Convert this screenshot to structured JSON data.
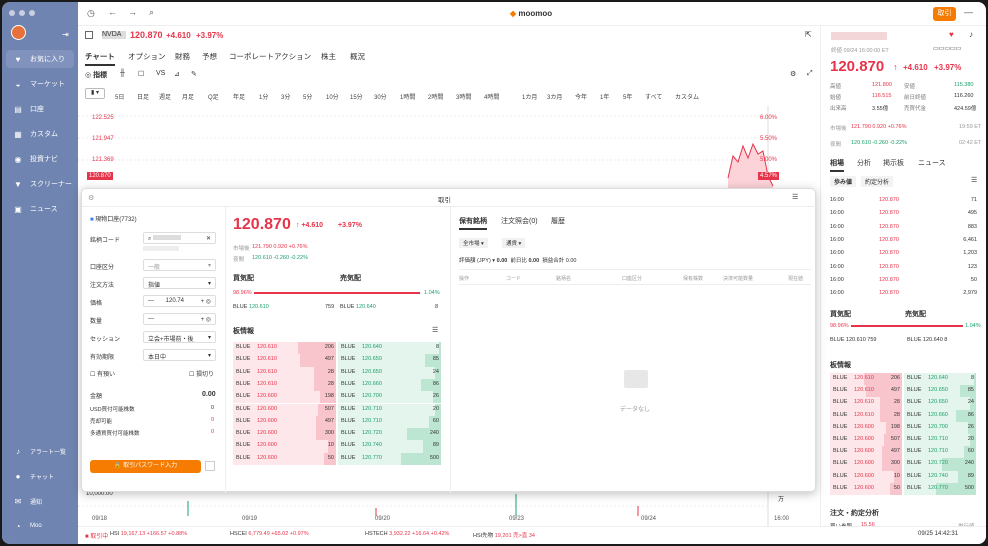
{
  "sidebar": {
    "items": [
      {
        "label": "お気に入り",
        "icon": "heart-icon",
        "glyph": "♥"
      },
      {
        "label": "マーケット",
        "icon": "market-icon",
        "glyph": "◒"
      },
      {
        "label": "口座",
        "icon": "wallet-icon",
        "glyph": "▤"
      },
      {
        "label": "カスタム",
        "icon": "custom-icon",
        "glyph": "▦"
      },
      {
        "label": "投資ナビ",
        "icon": "compass-icon",
        "glyph": "◉"
      },
      {
        "label": "スクリーナー",
        "icon": "filter-icon",
        "glyph": "▼"
      },
      {
        "label": "ニュース",
        "icon": "news-icon",
        "glyph": "▣"
      }
    ],
    "bottom": [
      {
        "label": "アラート一覧",
        "icon": "bell-icon",
        "glyph": "♪"
      },
      {
        "label": "チャット",
        "icon": "chat-icon",
        "glyph": "●"
      },
      {
        "label": "通知",
        "icon": "mail-icon",
        "glyph": "✉"
      },
      {
        "label": "Moo",
        "icon": "moo-icon",
        "glyph": "◔"
      }
    ]
  },
  "top": {
    "logo": "moomoo",
    "trade_btn": "取引"
  },
  "header": {
    "ticker": "NVDA",
    "price": "120.870",
    "change": "+4.610",
    "pct": "+3.97%"
  },
  "tabs": [
    "チャート",
    "オプション",
    "財務",
    "予想",
    "コーポレートアクション",
    "株主",
    "概況"
  ],
  "toolbar": {
    "indicator": "指標",
    "vs": "VS"
  },
  "timeframes": [
    "5日",
    "日足",
    "週足",
    "月足",
    "Q足",
    "年足",
    "1分",
    "3分",
    "5分",
    "10分",
    "15分",
    "30分",
    "1時間",
    "2時間",
    "3時間",
    "4時間",
    "1カ月",
    "3カ月",
    "今年",
    "1年",
    "5年",
    "すべて",
    "カスタム"
  ],
  "chart": {
    "y_labels": [
      "122.525",
      "121.947",
      "121.369",
      "120.870"
    ],
    "pct_labels": [
      "6.00%",
      "5.50%",
      "5.00%",
      "4.57%"
    ],
    "vol_label": "10,000.00",
    "vol_unit": "万",
    "x_labels": [
      "09/18",
      "09/19",
      "09/20",
      "09/23",
      "09/24",
      "16:00"
    ]
  },
  "dialog": {
    "title": "取引",
    "account": "現物口座(7732)",
    "labels": [
      "銘柄コード",
      "口座区分",
      "注文方法",
      "価格",
      "数量",
      "セッション",
      "有効期限"
    ],
    "acct_type": "一般",
    "order_type": "指値",
    "price": "120.74",
    "session": "立会+市場前・後",
    "expiry": "本日中",
    "chk1": "有預い",
    "chk2": "損切り",
    "amount_label": "金額",
    "amount": "0.00",
    "rows": [
      {
        "k": "USD買付可能株数",
        "v": "0"
      },
      {
        "k": "売却可能",
        "v": "0"
      },
      {
        "k": "多通貨買付可能株数",
        "v": "0"
      }
    ],
    "pwd_btn": "取引パスワード入力",
    "quote_price": "120.870",
    "quote_change": "+4.610",
    "quote_pct": "+3.97%",
    "pre_label": "市場後",
    "pre": "121.790  0.920  +0.76%",
    "post_label": "夜間",
    "post": "120.610  -0.260  -0.22%",
    "bid_label": "買気配",
    "ask_label": "売気配",
    "bid_pct": "98.96%",
    "ask_pct": "1.04%",
    "bid_ex": "BLUE",
    "bid_p": "120.610",
    "bid_q": "759",
    "ask_ex": "BLUE",
    "ask_p": "120.640",
    "ask_q": "8",
    "book_title": "板情報",
    "book": [
      [
        "BLUE",
        "120.610",
        "206",
        "BLUE",
        "120.640",
        "8"
      ],
      [
        "BLUE",
        "120.610",
        "497",
        "BLUE",
        "120.650",
        "85"
      ],
      [
        "BLUE",
        "120.610",
        "28",
        "BLUE",
        "120.650",
        "24"
      ],
      [
        "BLUE",
        "120.610",
        "28",
        "BLUE",
        "120.660",
        "86"
      ],
      [
        "BLUE",
        "120.600",
        "198",
        "BLUE",
        "120.700",
        "26"
      ],
      [
        "BLUE",
        "120.600",
        "507",
        "BLUE",
        "120.710",
        "20"
      ],
      [
        "BLUE",
        "120.600",
        "497",
        "BLUE",
        "120.710",
        "60"
      ],
      [
        "BLUE",
        "120.600",
        "300",
        "BLUE",
        "120.720",
        "240"
      ],
      [
        "BLUE",
        "120.600",
        "10",
        "BLUE",
        "120.740",
        "89"
      ],
      [
        "BLUE",
        "120.600",
        "50",
        "BLUE",
        "120.770",
        "500"
      ]
    ],
    "tabs": [
      "保有銘柄",
      "注文照会(0)",
      "履歴"
    ],
    "filter1": "全市場",
    "filter2": "通貨",
    "val_label": "評価額 (JPY)",
    "val": "0.00",
    "pnl_label": "前日比",
    "pnl": "0.00",
    "cost_label": "損益合計",
    "cost": "0.00",
    "cols": [
      "操作",
      "コード",
      "銘柄名",
      "口座区分",
      "保有株数",
      "決済可能数量",
      "現在値"
    ],
    "empty": "データなし"
  },
  "bottom": {
    "status": "取引中",
    "tickers": [
      {
        "n": "HSI",
        "v": "19,167.13",
        "c": "+166.57",
        "p": "+0.88%"
      },
      {
        "n": "HSCEI",
        "v": "6,779.49",
        "c": "+65.02",
        "p": "+0.97%"
      },
      {
        "n": "HSTECH",
        "v": "3,932.22",
        "c": "+16.64",
        "p": "+0.42%"
      },
      {
        "n": "HSI先物",
        "v": "19,201",
        "c": "売>直",
        "p": "34"
      }
    ],
    "time": "09/25 14:42:31"
  },
  "right": {
    "date": "終値 09/24 16:00:00 ET",
    "price": "120.870",
    "change": "+4.610",
    "pct": "+3.97%",
    "stats": [
      [
        "高値",
        "121.800",
        "安値",
        "115.380"
      ],
      [
        "始値",
        "116.515",
        "前日終値",
        "116.260"
      ],
      [
        "出来高",
        "3.55億",
        "売買代金",
        "424.59億"
      ]
    ],
    "after": {
      "label": "市場後",
      "v": "121.790  0.920  +0.76%",
      "t": "19:59 ET"
    },
    "night": {
      "label": "夜間",
      "v": "120.610  -0.260  -0.22%",
      "t": "02:42 ET"
    },
    "tabs": [
      "相場",
      "分析",
      "掲示板",
      "ニュース"
    ],
    "subtabs": [
      "歩み値",
      "約定分析"
    ],
    "trades": [
      [
        "16:00",
        "120.870",
        "71"
      ],
      [
        "16:00",
        "120.870",
        "495"
      ],
      [
        "16:00",
        "120.870",
        "883"
      ],
      [
        "16:00",
        "120.870",
        "6,461"
      ],
      [
        "16:00",
        "120.870",
        "1,203"
      ],
      [
        "16:00",
        "120.870",
        "123"
      ],
      [
        "16:00",
        "120.870",
        "50"
      ],
      [
        "16:00",
        "120.870",
        "2,979"
      ]
    ],
    "bid_label": "買気配",
    "ask_label": "売気配",
    "bid_pct": "98.96%",
    "ask_pct": "1.04%",
    "bid": "BLUE  120.610  759",
    "ask": "BLUE  120.640  8",
    "book_title": "板情報",
    "analysis": "注文・約定分析",
    "buy_label": "買い参照",
    "buy_val": "15.56",
    "sell_label": "単行値"
  }
}
